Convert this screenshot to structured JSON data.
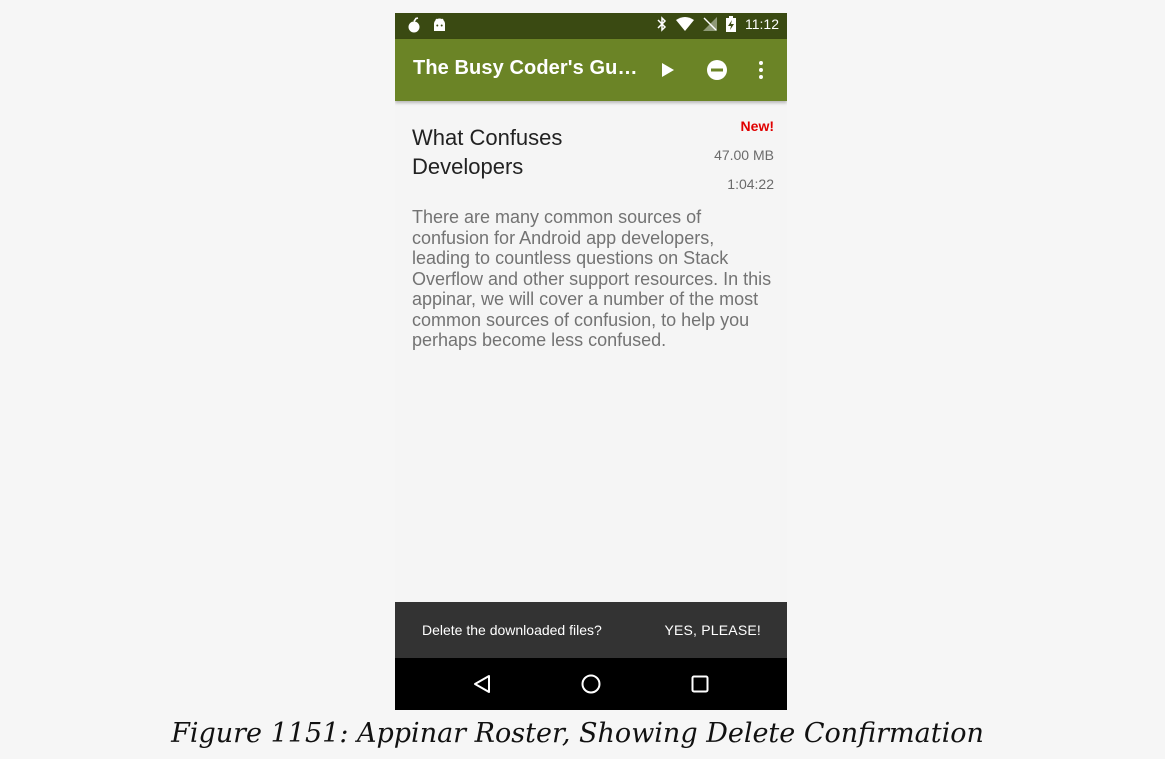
{
  "status_bar": {
    "time": "11:12",
    "icons_left": [
      "bomb-icon",
      "android-icon"
    ],
    "icons_right": [
      "bluetooth-icon",
      "wifi-icon",
      "no-signal-icon",
      "battery-charging-icon"
    ]
  },
  "app_bar": {
    "title": "The Busy Coder's Gu…",
    "actions": [
      "play-icon",
      "remove-circle-icon",
      "overflow-menu-icon"
    ],
    "color": "#6b8426"
  },
  "item": {
    "title": "What Confuses Developers",
    "badge": "New!",
    "size": "47.00 MB",
    "duration": "1:04:22",
    "description": "There are many common sources of confusion for Android app developers, leading to countless questions on Stack Overflow and other support resources. In this appinar, we will cover a number of the most common sources of confusion, to help you perhaps become less confused."
  },
  "snackbar": {
    "message": "Delete the downloaded files?",
    "action": "YES, PLEASE!"
  },
  "nav_bar": {
    "buttons": [
      "back-icon",
      "home-icon",
      "recents-icon"
    ]
  },
  "caption": "Figure 1151: Appinar Roster, Showing Delete Confirmation",
  "colors": {
    "status_bar": "#3a4a12",
    "badge": "#e00000",
    "snackbar": "#333333"
  }
}
